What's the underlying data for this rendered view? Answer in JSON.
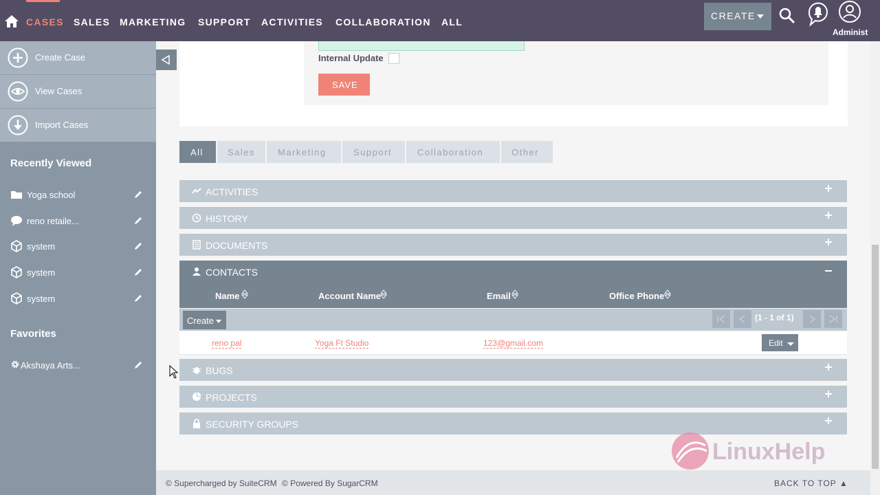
{
  "nav": {
    "items": [
      "CASES",
      "SALES",
      "MARKETING",
      "SUPPORT",
      "ACTIVITIES",
      "COLLABORATION",
      "ALL"
    ],
    "active": "CASES",
    "create_label": "CREATE",
    "user_label": "Administ"
  },
  "sidebar": {
    "actions": [
      {
        "label": "Create Case",
        "icon": "plus-circle-icon"
      },
      {
        "label": "View Cases",
        "icon": "eye-circle-icon"
      },
      {
        "label": "Import Cases",
        "icon": "download-circle-icon"
      }
    ],
    "recently_viewed_title": "Recently Viewed",
    "recently_viewed": [
      {
        "label": "Yoga school",
        "icon": "folder-icon"
      },
      {
        "label": "reno retaile...",
        "icon": "chat-icon"
      },
      {
        "label": "system",
        "icon": "cube-icon"
      },
      {
        "label": "system",
        "icon": "cube-icon"
      },
      {
        "label": "system",
        "icon": "cube-icon"
      }
    ],
    "favorites_title": "Favorites",
    "favorites": [
      {
        "label": "Akshaya Arts...",
        "icon": "gear-icon"
      }
    ]
  },
  "form": {
    "internal_update_label": "Internal Update",
    "save_label": "SAVE"
  },
  "tabs": [
    "All",
    "Sales",
    "Marketing",
    "Support",
    "Collaboration",
    "Other"
  ],
  "panels": {
    "activities": "ACTIVITIES",
    "history": "HISTORY",
    "documents": "DOCUMENTS",
    "contacts": "CONTACTS",
    "bugs": "BUGS",
    "projects": "PROJECTS",
    "security_groups": "SECURITY GROUPS"
  },
  "contacts": {
    "columns": [
      "Name",
      "Account Name",
      "Email",
      "Office Phone"
    ],
    "create_label": "Create",
    "pagination": "(1 - 1 of 1)",
    "rows": [
      {
        "name": "reno pal",
        "account": "Yoga Ft Studio",
        "email": "123@gmail.com",
        "phone": "",
        "edit": "Edit"
      }
    ]
  },
  "footer": {
    "supercharged": "© Supercharged by SuiteCRM",
    "powered": "© Powered By SugarCRM",
    "back_to_top": "BACK TO TOP"
  },
  "watermark": "LinuxHelp",
  "colors": {
    "nav_bg": "#534d64",
    "accent": "#f08377",
    "panel": "#bec8d1",
    "panel_dark": "#778591",
    "sidebar": "#8997a5"
  }
}
